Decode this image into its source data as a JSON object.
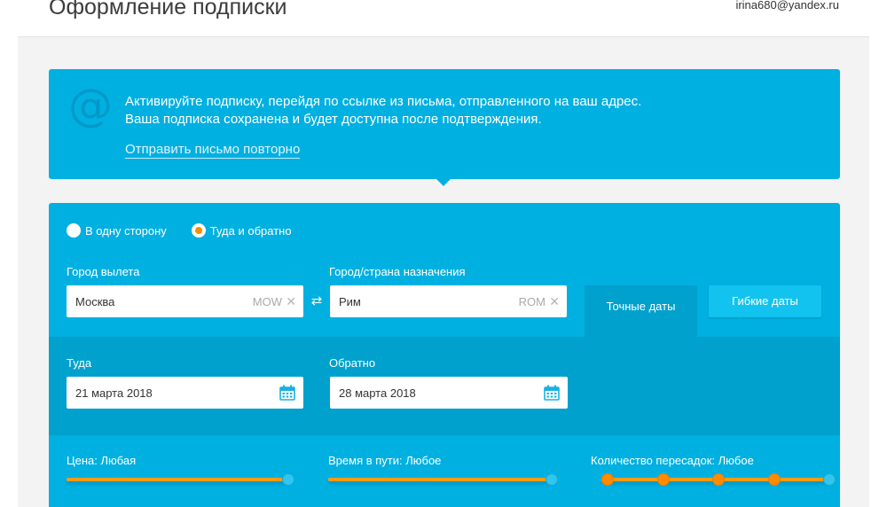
{
  "header": {
    "title": "Оформление подписки",
    "user_email": "irina680@yandex.ru"
  },
  "banner": {
    "line1": "Активируйте подписку, перейдя по ссылке из письма, отправленного на ваш адрес.",
    "line2": "Ваша подписка сохранена и будет доступна после подтверждения.",
    "resend_link": "Отправить письмо повторно",
    "icon": "at-icon"
  },
  "trip_type": {
    "options": [
      "В одну сторону",
      "Туда и обратно"
    ],
    "selected": "Туда и обратно"
  },
  "origin": {
    "label": "Город вылета",
    "value": "Москва",
    "code": "MOW"
  },
  "destination": {
    "label": "Город/страна назначения",
    "value": "Рим",
    "code": "ROM"
  },
  "date_tabs": {
    "exact": "Точные даты",
    "flexible": "Гибкие даты"
  },
  "dates": {
    "depart_label": "Туда",
    "depart_value": "21 марта 2018",
    "return_label": "Обратно",
    "return_value": "28 марта 2018"
  },
  "filters": {
    "price": "Цена: Любая",
    "duration": "Время в пути: Любое",
    "stops": "Количество пересадок: Любое"
  },
  "colors": {
    "accent": "#00b0e1",
    "accent_dark": "#00a1cd",
    "slider": "#ff9b14"
  }
}
